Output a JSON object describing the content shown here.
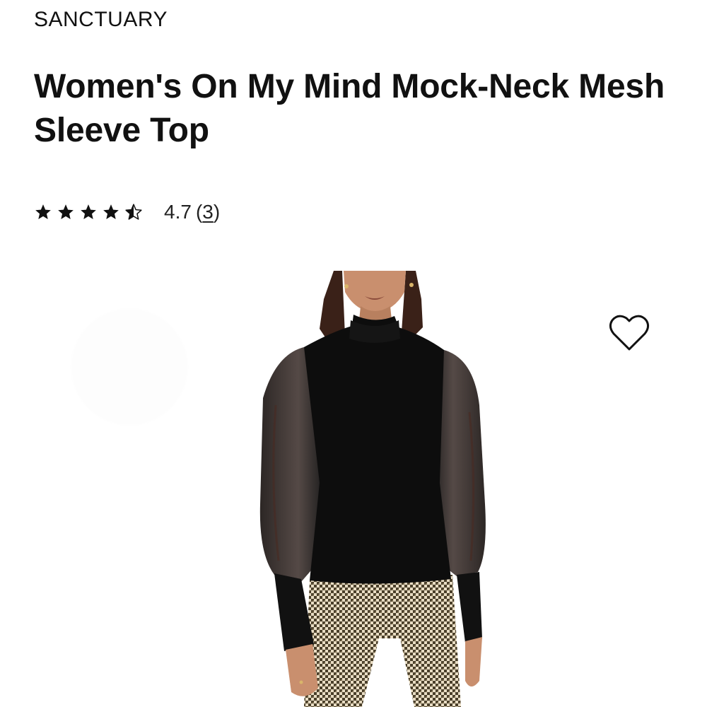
{
  "product": {
    "brand": "SANCTUARY",
    "title": "Women's On My Mind Mock-Neck Mesh Sleeve Top",
    "rating": {
      "stars": 4.7,
      "max_stars": 5,
      "value_text": "4.7",
      "count_open": "(",
      "count": "3",
      "count_close": ")"
    }
  },
  "icons": {
    "star": "star-icon",
    "half_star": "half-star-icon",
    "wishlist": "heart-outline-icon"
  },
  "colors": {
    "text": "#111111",
    "top": "#0d0d0d",
    "pants_light": "#e8dcc3",
    "pants_dark": "#4a3f2a",
    "skin": "#c98f6e",
    "hair": "#3a2118"
  }
}
